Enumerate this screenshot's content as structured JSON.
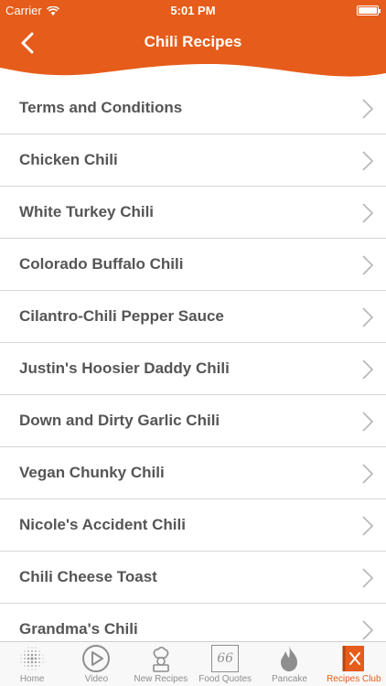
{
  "status_bar": {
    "carrier": "Carrier",
    "time": "5:01 PM"
  },
  "nav": {
    "title": "Chili Recipes",
    "accent": "#e65c1a"
  },
  "list": {
    "items": [
      "Terms and Conditions",
      "Chicken Chili",
      "White Turkey Chili",
      "Colorado Buffalo Chili",
      "Cilantro-Chili Pepper Sauce",
      "Justin's Hoosier Daddy Chili",
      "Down and Dirty Garlic Chili",
      "Vegan Chunky Chili",
      "Nicole's Accident Chili",
      "Chili Cheese Toast",
      "Grandma's Chili"
    ]
  },
  "tabbar": {
    "tabs": [
      {
        "label": "Home",
        "icon": "dots-grid-icon"
      },
      {
        "label": "Video",
        "icon": "play-circle-icon"
      },
      {
        "label": "New Recipes",
        "icon": "chef-icon"
      },
      {
        "label": "Food Quotes",
        "icon": "quote-icon",
        "glyph": "66"
      },
      {
        "label": "Pancake",
        "icon": "flame-icon"
      },
      {
        "label": "Recipes Club",
        "icon": "recipe-book-icon",
        "active": true
      }
    ]
  }
}
